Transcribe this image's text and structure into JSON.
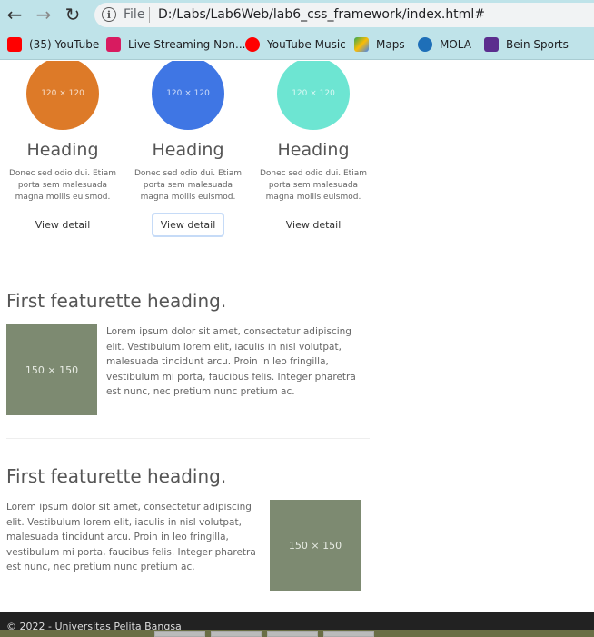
{
  "browser": {
    "scheme_label": "File",
    "url": "D:/Labs/Lab6Web/lab6_css_framework/index.html#",
    "back_icon": "←",
    "forward_icon": "→",
    "reload_icon": "↻",
    "info_icon": "i"
  },
  "bookmarks": [
    {
      "label": "(35) YouTube",
      "color": "#ff0000"
    },
    {
      "label": "Live Streaming Non...",
      "color": "#d81b60"
    },
    {
      "label": "YouTube Music",
      "color": "#ff0000"
    },
    {
      "label": "Maps",
      "color": "#34a853"
    },
    {
      "label": "MOLA",
      "color": "#1e6fb8"
    },
    {
      "label": "Bein Sports",
      "color": "#5b2d8e"
    }
  ],
  "columns": [
    {
      "placeholder": "120 × 120",
      "color": "#dd7a28",
      "heading": "Heading",
      "text": "Donec sed odio dui. Etiam porta sem malesuada magna mollis euismod.",
      "button": "View detail"
    },
    {
      "placeholder": "120 × 120",
      "color": "#3f76e4",
      "heading": "Heading",
      "text": "Donec sed odio dui. Etiam porta sem malesuada magna mollis euismod.",
      "button": "View detail"
    },
    {
      "placeholder": "120 × 120",
      "color": "#6de5d2",
      "heading": "Heading",
      "text": "Donec sed odio dui. Etiam porta sem malesuada magna mollis euismod.",
      "button": "View detail"
    }
  ],
  "featurettes": [
    {
      "heading": "First featurette heading.",
      "placeholder": "150 × 150",
      "text": "Lorem ipsum dolor sit amet, consectetur adipiscing elit. Vestibulum lorem elit, iaculis in nisl volutpat, malesuada tincidunt arcu. Proin in leo fringilla, vestibulum mi porta, faucibus felis. Integer pharetra est nunc, nec pretium nunc pretium ac."
    },
    {
      "heading": "First featurette heading.",
      "placeholder": "150 × 150",
      "text": "Lorem ipsum dolor sit amet, consectetur adipiscing elit. Vestibulum lorem elit, iaculis in nisl volutpat, malesuada tincidunt arcu. Proin in leo fringilla, vestibulum mi porta, faucibus felis. Integer pharetra est nunc, nec pretium nunc pretium ac."
    }
  ],
  "footer": {
    "text": "© 2022 - Universitas Pelita Bangsa"
  },
  "colors": {
    "placeholder_box": "#7d8a71",
    "toolbar": "#bfe3e9"
  }
}
